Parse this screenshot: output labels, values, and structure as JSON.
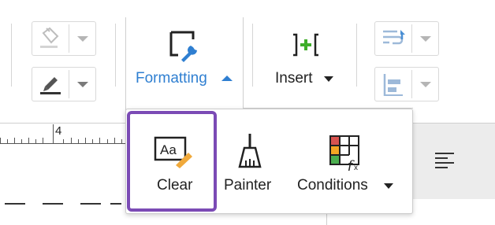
{
  "toolbar": {
    "formatting_label": "Formatting",
    "insert_label": "Insert",
    "fill_button_icon": "paint-bucket-icon",
    "text_color_icon": "pen-color-icon",
    "formatting_icon": "formatting-wrench-icon",
    "insert_icon": "insert-brackets-icon",
    "wrap_icon": "wrap-text-icon",
    "align_icon": "align-bottom-icon"
  },
  "ruler": {
    "marker_label": "4"
  },
  "formatting_menu": {
    "items": [
      {
        "label": "Clear",
        "icon": "clear-format-icon",
        "selected": true
      },
      {
        "label": "Painter",
        "icon": "format-painter-icon"
      },
      {
        "label": "Conditions",
        "icon": "conditional-format-icon",
        "has_dropdown": true
      }
    ]
  },
  "right_panel": {
    "icon": "align-left-icon"
  },
  "colors": {
    "accent": "#2f7fd1",
    "highlight": "#7b4bb5",
    "insert_plus": "#3fae2a",
    "eraser_orange": "#f0a93b",
    "cond_red": "#d9534f",
    "cond_orange": "#f5a623",
    "cond_green": "#4caf50"
  }
}
